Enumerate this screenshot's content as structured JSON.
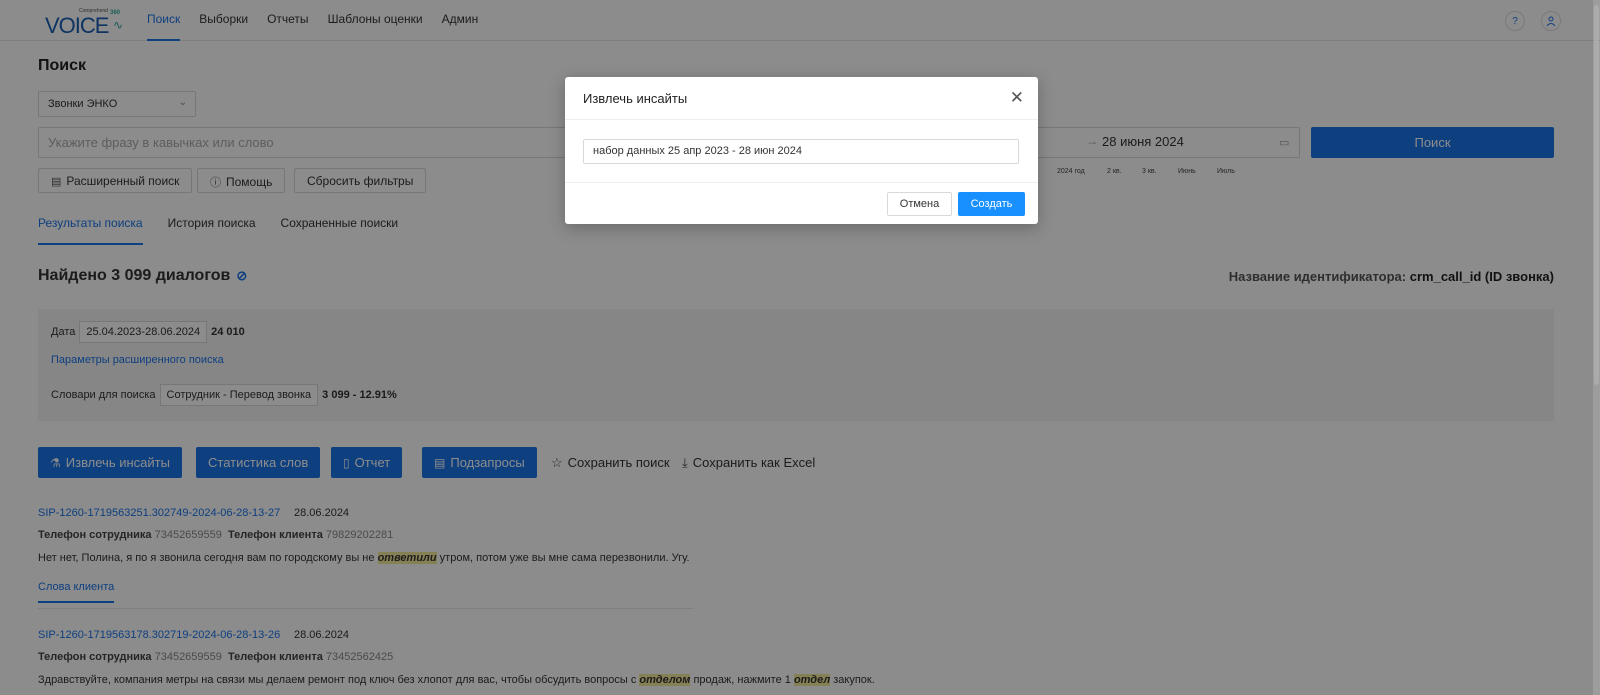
{
  "brand": {
    "small": "Comprehend",
    "main": "VOICE",
    "badge": "360"
  },
  "nav": {
    "items": [
      "Поиск",
      "Выборки",
      "Отчеты",
      "Шаблоны оценки",
      "Админ"
    ]
  },
  "page": {
    "title": "Поиск"
  },
  "source_select": {
    "value": "Звонки ЭНКО"
  },
  "search": {
    "placeholder": "Укажите фразу в кавычках или слово",
    "date_end": "28 июня 2024",
    "button": "Поиск"
  },
  "toolbar": {
    "advanced": "Расширенный поиск",
    "help": "Помощь",
    "reset": "Сбросить фильтры"
  },
  "timeline_ticks": [
    "2024 год",
    "2 кв.",
    "3 кв.",
    "Июнь",
    "Июль"
  ],
  "tabs": [
    "Результаты поиска",
    "История поиска",
    "Сохраненные поиски"
  ],
  "summary": {
    "found": "Найдено 3 099 диалогов",
    "ident_label": "Название идентификатора:",
    "ident_value": "crm_call_id (ID звонка)"
  },
  "filters": {
    "date_label": "Дата",
    "date_value": "25.04.2023-28.06.2024",
    "date_count": "24 010",
    "advanced_link": "Параметры расширенного поиска",
    "dict_label": "Словари для поиска",
    "dict_value": "Сотрудник - Перевод звонка",
    "dict_count": "3 099 - 12.91%"
  },
  "actions": {
    "insights": "Извлечь инсайты",
    "word_stats": "Статистика слов",
    "report": "Отчет",
    "subqueries": "Подзапросы",
    "save_search": "Сохранить поиск",
    "save_excel": "Сохранить как Excel"
  },
  "results": [
    {
      "id": "SIP-1260-1719563251.302749-2024-06-28-13-27",
      "date": "28.06.2024",
      "emp_label": "Телефон сотрудника",
      "emp_phone": "73452659559",
      "cli_label": "Телефон клиента",
      "cli_phone": "79829202281",
      "text_a": "Нет нет, Полина, я по я звонила сегодня вам по городскому вы не ",
      "hl_a": "ответили",
      "text_b": " утром, потом уже вы мне сама перезвонили. Угу."
    },
    {
      "id": "SIP-1260-1719563178.302719-2024-06-28-13-26",
      "date": "28.06.2024",
      "emp_label": "Телефон сотрудника",
      "emp_phone": "73452659559",
      "cli_label": "Телефон клиента",
      "cli_phone": "73452562425",
      "text_a": "Здравствуйте, компания метры на связи мы делаем ремонт под ключ без хлопот для вас, чтобы обсудить вопросы с ",
      "hl_a": "отделом",
      "text_b": " продаж, нажмите 1 ",
      "hl_b": "отдел",
      "text_c": " закупок."
    }
  ],
  "client_words_tab": "Слова клиента",
  "modal": {
    "title": "Извлечь инсайты",
    "input_value": "набор данных 25 апр 2023 - 28 июн 2024",
    "cancel": "Отмена",
    "create": "Создать"
  }
}
